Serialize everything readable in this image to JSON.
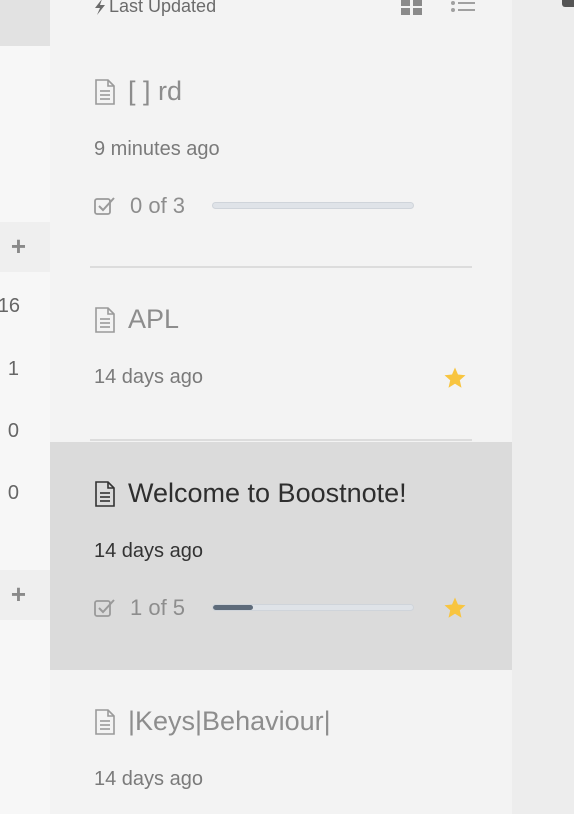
{
  "sidebar": {
    "counts": [
      "16",
      "1",
      "0",
      "0"
    ]
  },
  "note_list": {
    "sort_label": "Last Updated",
    "notes": [
      {
        "title": "[ ] rd",
        "date": "9 minutes ago",
        "tasks": "0 of 3",
        "progress": 0,
        "starred": false
      },
      {
        "title": "APL",
        "date": "14 days ago",
        "starred": true
      },
      {
        "title": "Welcome to Boostnote!",
        "date": "14 days ago",
        "tasks": "1 of 5",
        "progress": 0.2,
        "starred": true,
        "active": true
      },
      {
        "title": "|Keys|Behaviour|",
        "date": "14 days ago",
        "starred": false
      }
    ]
  },
  "colors": {
    "star": "#f8c540",
    "progress_fill": "#5e6b7a",
    "active_background": "#dbdbdb"
  },
  "icons": [
    "bolt-icon",
    "grid-view-icon",
    "list-view-icon",
    "note-document-icon",
    "checkbox-icon",
    "star-icon",
    "plus-icon"
  ]
}
